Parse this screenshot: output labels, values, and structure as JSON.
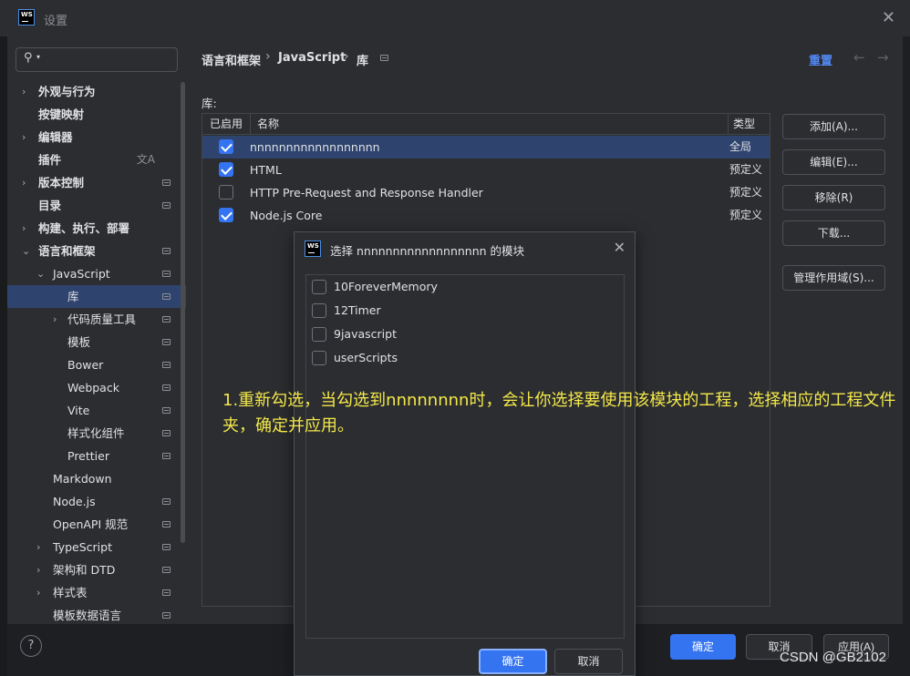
{
  "window": {
    "title": "设置"
  },
  "search": {
    "placeholder": ""
  },
  "sidebar": {
    "items": [
      {
        "label": "外观与行为"
      },
      {
        "label": "按键映射"
      },
      {
        "label": "编辑器"
      },
      {
        "label": "插件"
      },
      {
        "label": "版本控制"
      },
      {
        "label": "目录"
      },
      {
        "label": "构建、执行、部署"
      },
      {
        "label": "语言和框架"
      },
      {
        "label": "JavaScript"
      },
      {
        "label": "库"
      },
      {
        "label": "代码质量工具"
      },
      {
        "label": "模板"
      },
      {
        "label": "Bower"
      },
      {
        "label": "Webpack"
      },
      {
        "label": "Vite"
      },
      {
        "label": "样式化组件"
      },
      {
        "label": "Prettier"
      },
      {
        "label": "Markdown"
      },
      {
        "label": "Node.js"
      },
      {
        "label": "OpenAPI 规范"
      },
      {
        "label": "TypeScript"
      },
      {
        "label": "架构和 DTD"
      },
      {
        "label": "样式表"
      },
      {
        "label": "模板数据语言"
      }
    ]
  },
  "breadcrumb": {
    "part1": "语言和框架",
    "part2": "JavaScript",
    "part3": "库"
  },
  "header": {
    "reset": "重置"
  },
  "libraries": {
    "label": "库:",
    "columns": {
      "enabled": "已启用",
      "name": "名称",
      "type": "类型"
    },
    "rows": [
      {
        "name": "nnnnnnnnnnnnnnnnnn",
        "type": "全局",
        "checked": true
      },
      {
        "name": "HTML",
        "type": "预定义",
        "checked": true
      },
      {
        "name": "HTTP Pre-Request and Response Handler",
        "type": "预定义",
        "checked": false
      },
      {
        "name": "Node.js Core",
        "type": "预定义",
        "checked": true
      }
    ]
  },
  "actions": {
    "add": "添加(A)...",
    "edit": "编辑(E)...",
    "remove": "移除(R)",
    "download": "下载...",
    "scopes": "管理作用域(S)..."
  },
  "footer": {
    "ok": "确定",
    "cancel": "取消",
    "apply": "应用(A)"
  },
  "dialog": {
    "title": "选择 nnnnnnnnnnnnnnnnnn 的模块",
    "items": [
      "10ForeverMemory",
      "12Timer",
      "9javascript",
      "userScripts"
    ],
    "ok": "确定",
    "cancel": "取消"
  },
  "annotation": "1.重新勾选，当勾选到nnnnnnnn时，会让你选择要使用该模块的工程，选择相应的工程文件夹，确定并应用。",
  "watermark": "CSDN @GB2102",
  "colors": {
    "accent": "#3574f0",
    "selection": "#2e436e",
    "annotation": "#f5e84a",
    "link": "#548af7"
  }
}
